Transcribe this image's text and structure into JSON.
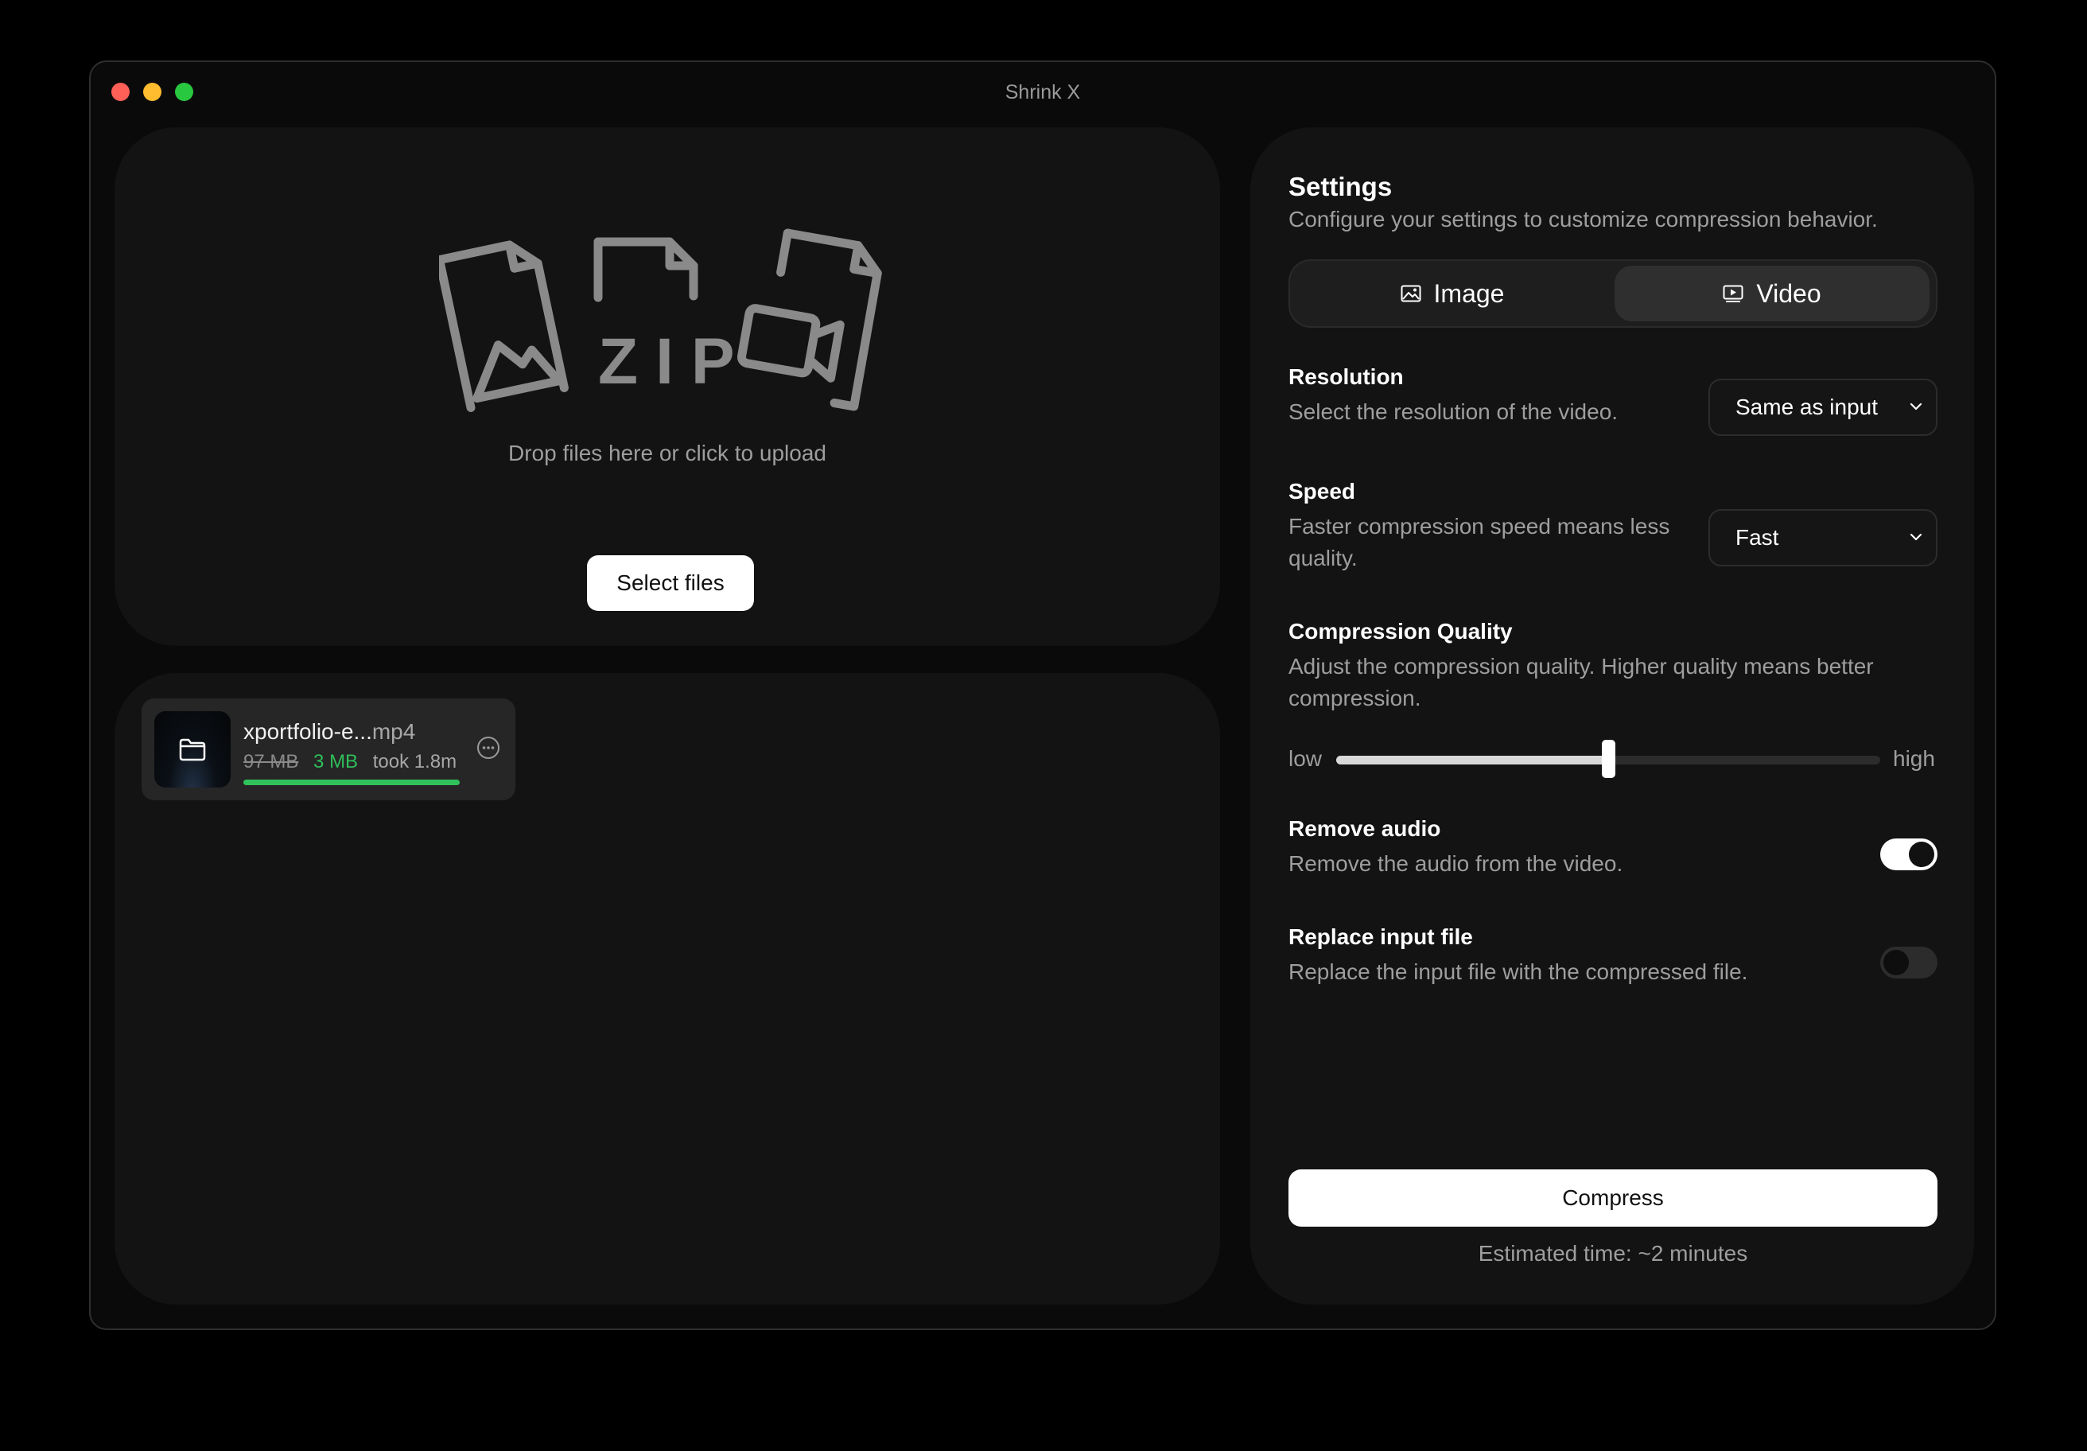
{
  "window": {
    "title": "Shrink X"
  },
  "dropzone": {
    "art_label": "ZIP",
    "text": "Drop files here or click to upload",
    "button_label": "Select files"
  },
  "files": [
    {
      "name": "xportfolio-e...",
      "ext": "mp4",
      "original_size": "97 MB",
      "compressed_size": "3 MB",
      "duration": "took 1.8m",
      "progress": 1.0
    }
  ],
  "settings": {
    "title": "Settings",
    "subtitle": "Configure your settings to customize compression behavior.",
    "tabs": [
      {
        "label": "Image",
        "icon": "image-icon",
        "selected": false
      },
      {
        "label": "Video",
        "icon": "video-icon",
        "selected": true
      }
    ],
    "resolution": {
      "label": "Resolution",
      "description": "Select the resolution of the video.",
      "value": "Same as input"
    },
    "speed": {
      "label": "Speed",
      "description": "Faster compression speed means less quality.",
      "value": "Fast"
    },
    "quality": {
      "label": "Compression Quality",
      "description": "Adjust the compression quality. Higher quality means better compression.",
      "low_label": "low",
      "high_label": "high",
      "value": 0.5
    },
    "remove_audio": {
      "label": "Remove audio",
      "description": "Remove the audio from the video.",
      "enabled": true
    },
    "replace_input": {
      "label": "Replace input file",
      "description": "Replace the input file with the compressed file.",
      "enabled": false
    },
    "compress_label": "Compress",
    "estimate": "Estimated time: ~2 minutes"
  },
  "colors": {
    "success": "#2fc35b",
    "window_bg": "#0a0a0a",
    "panel_bg": "#131313"
  }
}
